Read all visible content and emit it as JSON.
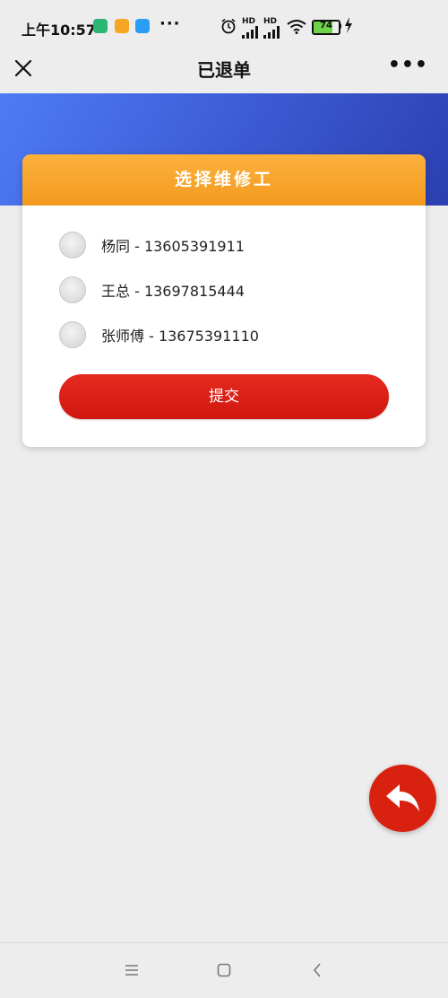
{
  "status_bar": {
    "time": "上午10:57",
    "more": "···",
    "signal_label_1": "HD",
    "signal_label_2": "HD",
    "battery_level": "74",
    "battery_fraction": 0.74
  },
  "nav": {
    "title": "已退单",
    "close_icon": "close-icon",
    "more_label": "•••"
  },
  "card": {
    "header": "选择维修工",
    "options": [
      {
        "label": "杨同 - 13605391911",
        "selected": false
      },
      {
        "label": "王总 - 13697815444",
        "selected": false
      },
      {
        "label": "张师傅 - 13675391110",
        "selected": false
      }
    ],
    "submit_label": "提交"
  },
  "colors": {
    "header_orange": "#f5a623",
    "submit_red": "#d91a12",
    "band_blue": "#3e5fd8",
    "fab_red": "#d9210f"
  },
  "icons": {
    "fab": "reply-arrow-icon",
    "sys_menu": "menu-icon",
    "sys_home": "home-square-icon",
    "sys_back": "chevron-left-icon"
  }
}
